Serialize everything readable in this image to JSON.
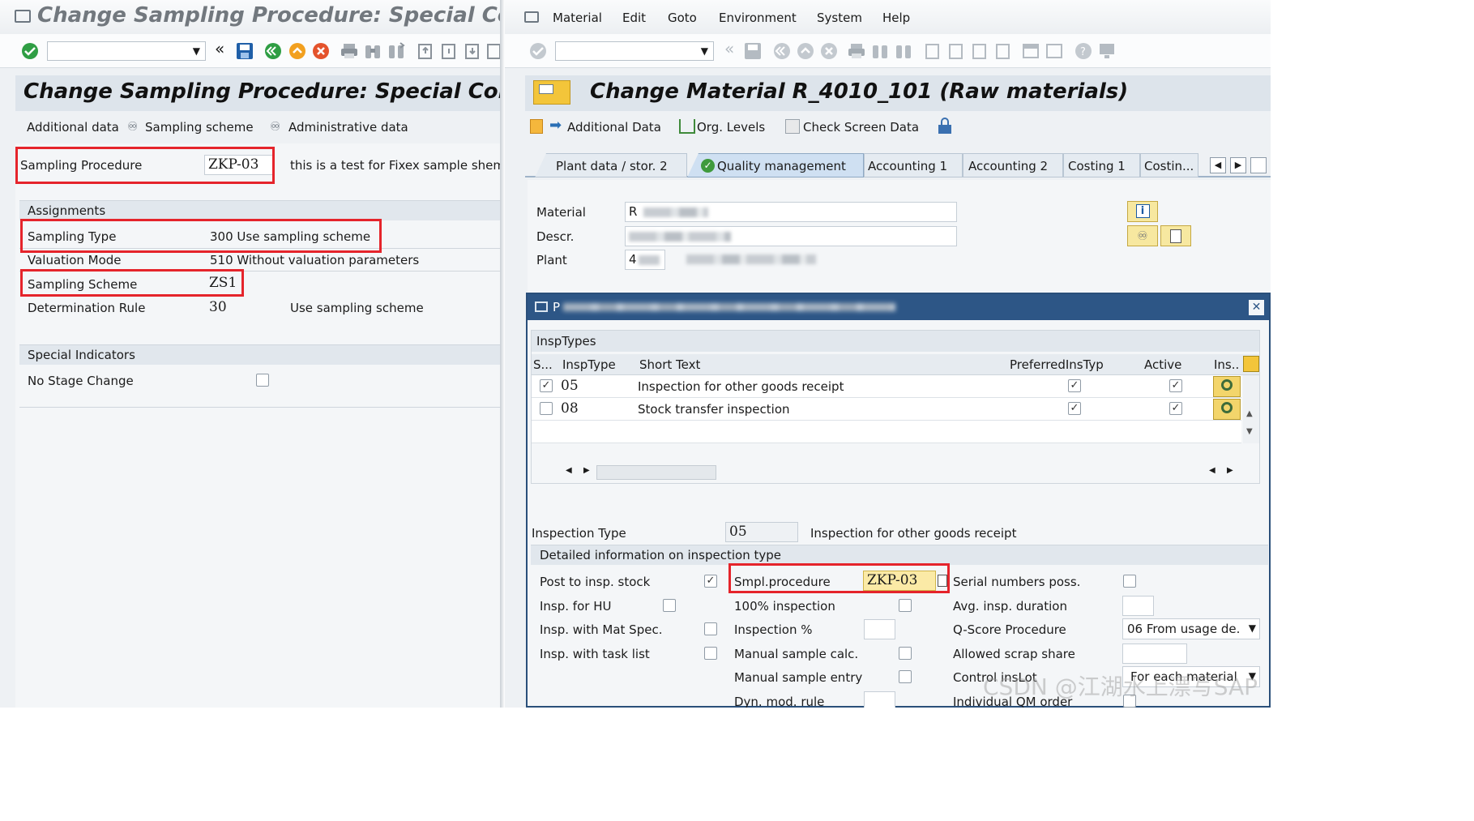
{
  "left": {
    "window_title": "Change Sampling Procedure: Special Conditio",
    "page_title": "Change Sampling Procedure: Special Condition",
    "menu": [
      "Additional data",
      "Sampling scheme",
      "Administrative data"
    ],
    "sampling_procedure": {
      "label": "Sampling Procedure",
      "value": "ZKP-03",
      "description": "this is a test for Fixex sample shem"
    },
    "assignments": {
      "header": "Assignments",
      "sampling_type": {
        "label": "Sampling Type",
        "value": "300 Use sampling scheme"
      },
      "valuation_mode": {
        "label": "Valuation Mode",
        "value": "510 Without valuation parameters"
      },
      "sampling_scheme": {
        "label": "Sampling Scheme",
        "value": "ZS1"
      },
      "determination_rule": {
        "label": "Determination Rule",
        "value": "30",
        "text": "Use sampling scheme"
      }
    },
    "special": {
      "header": "Special Indicators",
      "no_stage_change": "No Stage Change"
    }
  },
  "right": {
    "menubar": [
      "Material",
      "Edit",
      "Goto",
      "Environment",
      "System",
      "Help"
    ],
    "page_title": "Change Material R_4010_101 (Raw materials)",
    "toolbar": [
      "Additional Data",
      "Org. Levels",
      "Check Screen Data"
    ],
    "tabs": [
      "Plant data / stor. 2",
      "Quality management",
      "Accounting 1",
      "Accounting 2",
      "Costing 1",
      "Costin..."
    ],
    "fields": {
      "material": "Material",
      "descr": "Descr.",
      "plant": "Plant",
      "material_value_prefix": "R",
      "plant_value_prefix": "4"
    },
    "dialog": {
      "title_prefix": "P",
      "section": "InspTypes",
      "columns": [
        "S...",
        "InspType",
        "Short Text",
        "PreferredInsTyp",
        "Active",
        "Ins.."
      ],
      "rows": [
        {
          "sel": true,
          "type": "05",
          "text": "Inspection for other goods receipt",
          "preferred": true,
          "active": true
        },
        {
          "sel": false,
          "type": "08",
          "text": "Stock transfer inspection",
          "preferred": true,
          "active": true
        }
      ],
      "inspection_type": {
        "label": "Inspection Type",
        "value": "05",
        "text": "Inspection for other goods receipt"
      },
      "detail_header": "Detailed information on inspection type",
      "col1": [
        "Post to insp. stock",
        "Insp. for HU",
        "Insp. with Mat Spec.",
        "Insp. with task list"
      ],
      "col2": [
        "Smpl.procedure",
        "100% inspection",
        "Inspection %",
        "Manual sample calc.",
        "Manual sample entry",
        "Dyn. mod. rule"
      ],
      "smpl_value": "ZKP-03",
      "col3": [
        "Serial numbers poss.",
        "Avg. insp. duration",
        "Q-Score Procedure",
        "Allowed scrap share",
        "Control insLot",
        "Individual QM order"
      ],
      "qscore_value": "06 From usage de.",
      "control_value": "For each material"
    },
    "watermark": "CSDN @江湖水上漂写SAP"
  },
  "colors": {
    "red": "#e5242b",
    "header_bg": "#dfe6ee",
    "dialog_border": "#2a4f7a",
    "accent_green": "#2f9e44"
  }
}
